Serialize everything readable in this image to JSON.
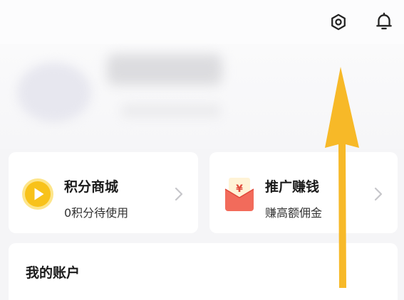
{
  "header": {
    "settings_icon": "gear-icon",
    "notification_icon": "bell-icon"
  },
  "profile": {
    "avatar": "blurred",
    "name": "",
    "subtitle": ""
  },
  "cards": [
    {
      "icon": "coin-play-icon",
      "title": "积分商城",
      "subtitle": "0积分待使用",
      "accent": "#f9c21a"
    },
    {
      "icon": "red-packet-icon",
      "title": "推广赚钱",
      "subtitle": "赚高额佣金",
      "accent": "#f26b5b"
    }
  ],
  "account": {
    "title": "我的账户"
  },
  "annotation": {
    "type": "arrow-up",
    "color": "#f7b928"
  }
}
